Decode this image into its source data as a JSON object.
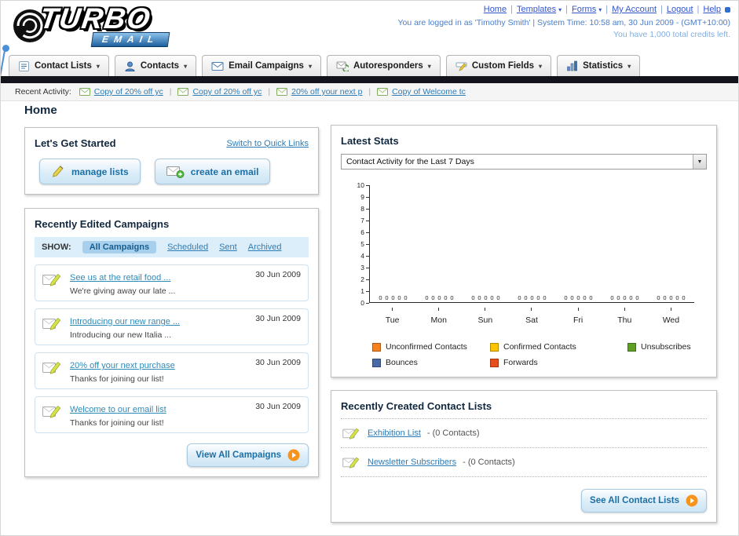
{
  "colors": {
    "link_blue": "#2e7cb5",
    "heading_navy": "#12283f",
    "dark_bar": "#14141d",
    "button_text": "#1c6fa6",
    "top_link_blue": "#3355cc"
  },
  "header": {
    "logo": {
      "line1": "TURBO",
      "line2": "EMAIL"
    },
    "top_links": {
      "home": "Home",
      "templates": "Templates",
      "forms": "Forms",
      "my_account": "My Account",
      "logout": "Logout",
      "help": "Help"
    },
    "login_info": "You are logged in as 'Timothy Smith' | System Time: 10:58 am, 30 Jun 2009 - (GMT+10:00)",
    "credits_info": "You have 1,000 total credits left."
  },
  "main_nav": {
    "items": [
      {
        "label": "Contact Lists"
      },
      {
        "label": "Contacts"
      },
      {
        "label": "Email Campaigns"
      },
      {
        "label": "Autoresponders"
      },
      {
        "label": "Custom Fields"
      },
      {
        "label": "Statistics"
      }
    ]
  },
  "recent_activity": {
    "label": "Recent Activity:",
    "items": [
      {
        "label": "Copy of 20% off yc"
      },
      {
        "label": "Copy of 20% off yc"
      },
      {
        "label": "20% off your next p"
      },
      {
        "label": "Copy of Welcome tc"
      }
    ]
  },
  "page": {
    "title": "Home"
  },
  "get_started": {
    "title": "Let's Get Started",
    "switch_link": "Switch to Quick Links",
    "manage_lists_label": "manage lists",
    "create_email_label": "create an email"
  },
  "campaigns": {
    "title": "Recently Edited Campaigns",
    "show_label": "SHOW:",
    "tabs": [
      {
        "label": "All Campaigns",
        "active": true
      },
      {
        "label": "Scheduled",
        "active": false
      },
      {
        "label": "Sent",
        "active": false
      },
      {
        "label": "Archived",
        "active": false
      }
    ],
    "items": [
      {
        "title": "See us at the retail food ...",
        "subtitle": "We're giving away our late ...",
        "date": "30 Jun 2009"
      },
      {
        "title": "Introducing our new range ...",
        "subtitle": "Introducing our new Italia ...",
        "date": "30 Jun 2009"
      },
      {
        "title": "20% off your next purchase",
        "subtitle": "Thanks for joining our list!",
        "date": "30 Jun 2009"
      },
      {
        "title": "Welcome to our email list",
        "subtitle": "Thanks for joining our list!",
        "date": "30 Jun 2009"
      }
    ],
    "view_all_label": "View All Campaigns"
  },
  "stats": {
    "title": "Latest Stats",
    "dropdown_value": "Contact Activity for the Last 7 Days",
    "chart_data": {
      "type": "bar",
      "title": "Contact Activity for the Last 7 Days",
      "categories": [
        "Tue",
        "Mon",
        "Sun",
        "Sat",
        "Fri",
        "Thu",
        "Wed"
      ],
      "series": [
        {
          "name": "Unconfirmed Contacts",
          "color": "#f5821f",
          "values": [
            0,
            0,
            0,
            0,
            0,
            0,
            0
          ]
        },
        {
          "name": "Confirmed Contacts",
          "color": "#fdc500",
          "values": [
            0,
            0,
            0,
            0,
            0,
            0,
            0
          ]
        },
        {
          "name": "Unsubscribes",
          "color": "#5fa024",
          "values": [
            0,
            0,
            0,
            0,
            0,
            0,
            0
          ]
        },
        {
          "name": "Bounces",
          "color": "#4a69a5",
          "values": [
            0,
            0,
            0,
            0,
            0,
            0,
            0
          ]
        },
        {
          "name": "Forwards",
          "color": "#e84e1b",
          "values": [
            0,
            0,
            0,
            0,
            0,
            0,
            0
          ]
        }
      ],
      "xlabel": "",
      "ylabel": "",
      "ylim": [
        0,
        10
      ],
      "yticks": [
        0,
        1,
        2,
        3,
        4,
        5,
        6,
        7,
        8,
        9,
        10
      ],
      "grid": false,
      "legend_position": "bottom"
    }
  },
  "contact_lists": {
    "title": "Recently Created Contact Lists",
    "items": [
      {
        "name": "Exhibition List",
        "detail": "- (0 Contacts)"
      },
      {
        "name": "Newsletter Subscribers",
        "detail": "- (0 Contacts)"
      }
    ],
    "see_all_label": "See All Contact Lists"
  }
}
